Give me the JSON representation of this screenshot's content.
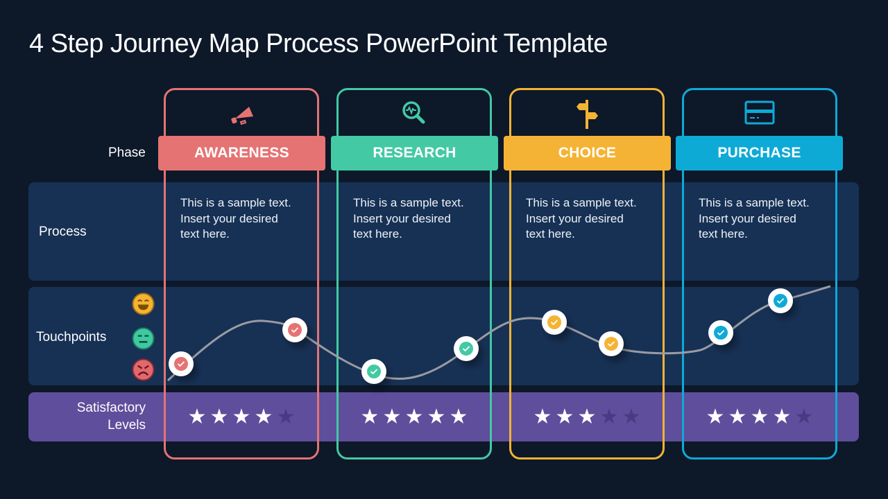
{
  "title": "4 Step Journey Map Process PowerPoint Template",
  "row_labels": {
    "phase": "Phase",
    "process": "Process",
    "touchpoints": "Touchpoints",
    "satisfactory_line1": "Satisfactory",
    "satisfactory_line2": "Levels"
  },
  "colors": {
    "background": "#0d1829",
    "row_bg": "#173155",
    "satisfaction_bg": "#5e4e9b",
    "curve": "#9a9ca3"
  },
  "emotion_scale": [
    {
      "icon": "happy-face-icon",
      "color": "#f5b335"
    },
    {
      "icon": "neutral-face-icon",
      "color": "#3ec9a0"
    },
    {
      "icon": "angry-face-icon",
      "color": "#e0696d"
    }
  ],
  "phases": [
    {
      "name": "AWARENESS",
      "color": "#e57373",
      "icon": "megaphone-icon",
      "process_text": [
        "This is a sample text.",
        "Insert your desired",
        "text here."
      ],
      "rating": 4,
      "max_rating": 5
    },
    {
      "name": "RESEARCH",
      "color": "#43c9a4",
      "icon": "magnifier-pulse-icon",
      "process_text": [
        "This is a sample text.",
        "Insert your desired",
        "text here."
      ],
      "rating": 5,
      "max_rating": 5
    },
    {
      "name": "CHOICE",
      "color": "#f5b335",
      "icon": "signpost-icon",
      "process_text": [
        "This is a sample text.",
        "Insert your desired",
        "text here."
      ],
      "rating": 3,
      "max_rating": 5
    },
    {
      "name": "PURCHASE",
      "color": "#0eaad6",
      "icon": "credit-card-icon",
      "process_text": [
        "This is a sample text.",
        "Insert your desired",
        "text here."
      ],
      "rating": 4,
      "max_rating": 5
    }
  ],
  "touchpoints": [
    {
      "phase": 0,
      "level": "low"
    },
    {
      "phase": 0,
      "level": "high"
    },
    {
      "phase": 1,
      "level": "low"
    },
    {
      "phase": 1,
      "level": "mid"
    },
    {
      "phase": 2,
      "level": "high"
    },
    {
      "phase": 2,
      "level": "mid"
    },
    {
      "phase": 3,
      "level": "mid"
    },
    {
      "phase": 3,
      "level": "high"
    }
  ]
}
